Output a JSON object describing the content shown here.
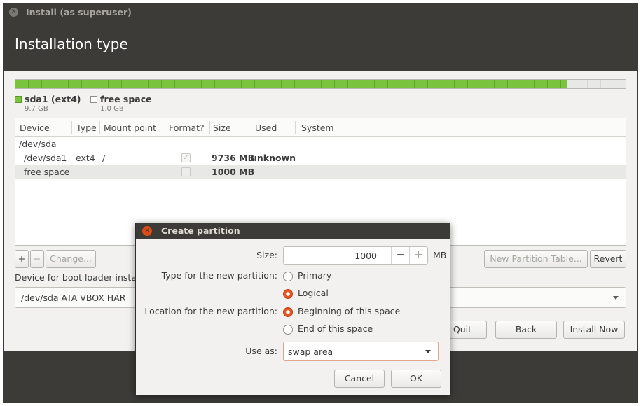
{
  "window": {
    "title": "Install (as superuser)",
    "heading": "Installation type"
  },
  "bar": {
    "used_fraction": 0.905,
    "colors": {
      "used": "#7ac33e",
      "free": "#e8e8e6"
    }
  },
  "legend": [
    {
      "name": "sda1 (ext4)",
      "size": "9.7 GB",
      "color": "#7ac33e"
    },
    {
      "name": "free space",
      "size": "1.0 GB",
      "color": "#ffffff"
    }
  ],
  "table": {
    "columns": [
      "Device",
      "Type",
      "Mount point",
      "Format?",
      "Size",
      "Used",
      "System"
    ],
    "rows": [
      {
        "device": "/dev/sda",
        "type": "",
        "mount": "",
        "format": "",
        "size": "",
        "used": "",
        "system": ""
      },
      {
        "device": "/dev/sda1",
        "type": "ext4",
        "mount": "/",
        "format": "✓",
        "size": "9736 MB",
        "used": "unknown",
        "system": ""
      },
      {
        "device": "free space",
        "type": "",
        "mount": "",
        "format": "",
        "size": "1000 MB",
        "used": "",
        "system": ""
      }
    ]
  },
  "controls": {
    "add": "+",
    "remove": "−",
    "change": "Change...",
    "new_table": "New Partition Table...",
    "revert": "Revert"
  },
  "bootloader": {
    "label": "Device for boot loader insta",
    "value": "/dev/sda   ATA VBOX HAR"
  },
  "nav": {
    "quit": "Quit",
    "back": "Back",
    "install": "Install Now"
  },
  "dialog": {
    "title": "Create partition",
    "size_label": "Size:",
    "size_value": "1000",
    "size_minus": "−",
    "size_plus": "+",
    "size_unit": "MB",
    "type_label": "Type for the new partition:",
    "type_primary": "Primary",
    "type_logical": "Logical",
    "type_selected": "Logical",
    "location_label": "Location for the new partition:",
    "loc_beginning": "Beginning of this space",
    "loc_end": "End of this space",
    "loc_selected": "Beginning of this space",
    "use_as_label": "Use as:",
    "use_as_value": "swap area",
    "cancel": "Cancel",
    "ok": "OK",
    "accent": "#e95420"
  }
}
